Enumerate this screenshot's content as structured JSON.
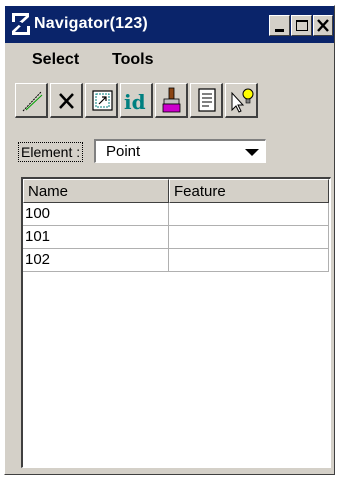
{
  "window": {
    "title": "Navigator(123)",
    "accent": "#0a246a",
    "face": "#d4d0c8"
  },
  "menu": {
    "items": [
      "Select",
      "Tools"
    ]
  },
  "toolbar": {
    "buttons": [
      "line-select-icon",
      "delete-x-icon",
      "zoom-to-icon",
      "id-icon",
      "paintbrush-icon",
      "report-document-icon",
      "pointer-bulb-icon"
    ]
  },
  "element": {
    "label": "Element :",
    "value": "Point"
  },
  "table": {
    "columns": [
      "Name",
      "Feature"
    ],
    "rows": [
      [
        "100",
        ""
      ],
      [
        "101",
        ""
      ],
      [
        "102",
        ""
      ]
    ]
  }
}
